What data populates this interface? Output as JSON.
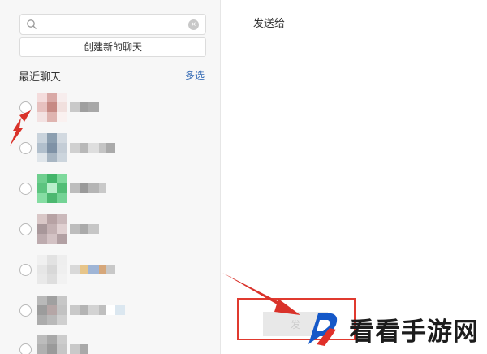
{
  "search": {
    "placeholder": "",
    "value": "",
    "clear_glyph": "×"
  },
  "create_chat": {
    "label": "创建新的聊天"
  },
  "recent": {
    "title": "最近聊天",
    "multi_select": "多选"
  },
  "contacts": [
    {
      "avatar": [
        "#f4dcdc",
        "#d9a9a6",
        "#f7eded",
        "#e7c1bf",
        "#c78a84",
        "#f1e0de",
        "#f3e2e2",
        "#dfb4b0",
        "#faf1f0"
      ],
      "name": [
        "#c9c9c9",
        "#9f9f9f",
        "#a8a8a8"
      ]
    },
    {
      "avatar": [
        "#c9d3dc",
        "#8c9fb0",
        "#d2d9e0",
        "#b1bfcc",
        "#7f92a6",
        "#c4cdd6",
        "#dfe5ea",
        "#a8b6c3",
        "#ccd5dd"
      ],
      "name": [
        "#d0d0d0",
        "#b8b8b8",
        "#dedede",
        "#c4c4c4",
        "#aaaaaa"
      ]
    },
    {
      "avatar": [
        "#6fcf8f",
        "#43b56a",
        "#7ed99c",
        "#5cc47f",
        "#b9efcb",
        "#51bd75",
        "#86dda3",
        "#4cb870",
        "#74d395"
      ],
      "name": [
        "#bdbdbd",
        "#9a9a9a",
        "#b5b5b5",
        "#c9c9c9"
      ]
    },
    {
      "avatar": [
        "#d9c7c7",
        "#b7a2a4",
        "#cbb9bb",
        "#a8979a",
        "#c4b1b3",
        "#e0d0d1",
        "#bdabae",
        "#d3c2c4",
        "#b2a0a3"
      ],
      "name": [
        "#bdbdbd",
        "#aaaaaa",
        "#c6c6c6"
      ]
    },
    {
      "avatar": [
        "#f0f0f0",
        "#e2e2e2",
        "#eeeeee",
        "#e6e6e6",
        "#d8d8d8",
        "#efefef",
        "#e9e9e9",
        "#dedede",
        "#f2f2f2"
      ],
      "name": [
        "#d9d9d9",
        "#e7c58a",
        "#9fb5d6",
        "#d6a77a",
        "#c8c8c8"
      ]
    },
    {
      "avatar": [
        "#b9b9b9",
        "#a0a0a0",
        "#c7c7c7",
        "#9c9c9c",
        "#b5a6a6",
        "#c2c2c2",
        "#acacac",
        "#b9b9b9",
        "#cfcfcf"
      ],
      "name": [
        "#c9c9c9",
        "#b4b4b4",
        "#d3d3d3",
        "#bfbfbf",
        "#ffffff",
        "#dbe7f0"
      ]
    },
    {
      "avatar": [
        "#bcbcbc",
        "#a8a8a8",
        "#cccccc",
        "#b0b0b0",
        "#9a9a9a",
        "#c6c6c6",
        "#dddddd",
        "#cfcfcf",
        "#e8e8e8"
      ],
      "name": [
        "#c9c9c9",
        "#a9a9a9"
      ]
    }
  ],
  "right": {
    "title": "发送给",
    "send_label": "发"
  },
  "colors": {
    "accent": "#3a6fb7",
    "annotation": "#e03a2f"
  },
  "watermark": {
    "text": "看看手游网"
  }
}
